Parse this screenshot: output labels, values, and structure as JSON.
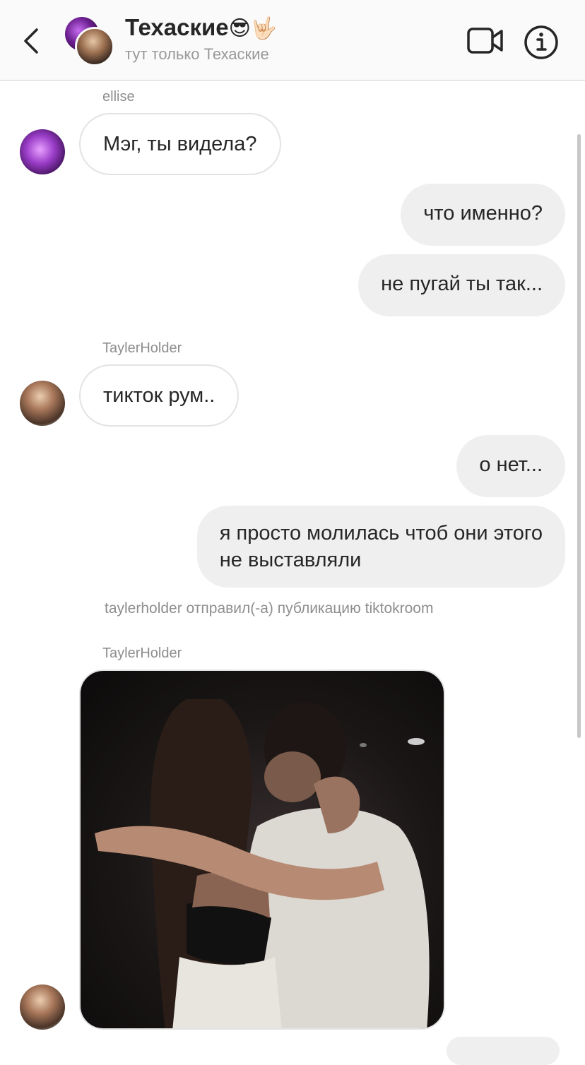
{
  "header": {
    "title": "Техаские",
    "title_emoji": "😎🤟🏻",
    "subtitle": "тут только Техаские"
  },
  "messages": [
    {
      "sender": "ellise",
      "text": "Мэг, ты видела?"
    },
    {
      "text": "что именно?"
    },
    {
      "text": "не пугай ты так..."
    },
    {
      "sender": "TaylerHolder",
      "text": "тикток рум.."
    },
    {
      "text": "о нет..."
    },
    {
      "text_line1": "я просто молилась чтоб они этого",
      "text_line2": "не выставляли"
    },
    {
      "system": "taylerholder отправил(-а) публикацию tiktokroom"
    },
    {
      "sender": "TaylerHolder",
      "attachment": "photo"
    }
  ],
  "colors": {
    "incoming_bubble": "#ffffff",
    "outgoing_bubble": "#efefef",
    "meta_text": "#8e8e8e"
  }
}
